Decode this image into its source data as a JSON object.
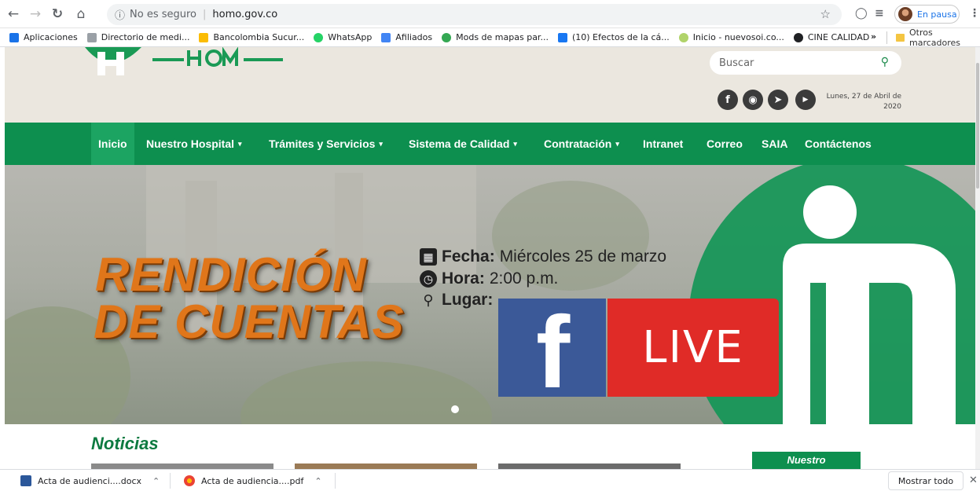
{
  "browser": {
    "security_label": "No es seguro",
    "url": "homo.gov.co",
    "profile_label": "En pausa"
  },
  "bookmarks": {
    "items": [
      {
        "label": "Aplicaciones",
        "color": "#1a73e8"
      },
      {
        "label": "Directorio de medi...",
        "color": "#9aa0a6"
      },
      {
        "label": "Bancolombia Sucur...",
        "color": "#fbbc04"
      },
      {
        "label": "WhatsApp",
        "color": "#25d366"
      },
      {
        "label": "Afiliados",
        "color": "#4285f4"
      },
      {
        "label": "Mods de mapas par...",
        "color": "#34a853"
      },
      {
        "label": "(10) Efectos de la cá...",
        "color": "#1877f2"
      },
      {
        "label": "Inicio - nuevosoi.co...",
        "color": "#b0d36a"
      },
      {
        "label": "CINE CALIDAD",
        "color": "#202124"
      }
    ],
    "more": "»",
    "other": "Otros marcadores"
  },
  "site": {
    "search_placeholder": "Buscar",
    "date": "Lunes, 27 de Abril de 2020",
    "brand_color": "#0d8f4f",
    "nav": [
      {
        "label": "Inicio",
        "dropdown": false
      },
      {
        "label": "Nuestro Hospital",
        "dropdown": true
      },
      {
        "label": "Trámites y Servicios",
        "dropdown": true
      },
      {
        "label": "Sistema de Calidad",
        "dropdown": true
      },
      {
        "label": "Contratación",
        "dropdown": true
      },
      {
        "label": "Intranet",
        "dropdown": false
      },
      {
        "label": "Correo",
        "dropdown": false
      },
      {
        "label": "SAIA",
        "dropdown": false
      },
      {
        "label": "Contáctenos",
        "dropdown": false
      }
    ],
    "hero": {
      "title_line1": "RENDICIÓN",
      "title_line2": "DE CUENTAS",
      "fecha_label": "Fecha:",
      "fecha_value": "Miércoles 25 de marzo",
      "hora_label": "Hora:",
      "hora_value": "2:00 p.m.",
      "lugar_label": "Lugar:",
      "live_f": "f",
      "live_text": "LIVE"
    },
    "news_heading": "Noticias",
    "side_heading": "Nuestro"
  },
  "downloads": {
    "items": [
      {
        "label": "Acta de audienci....docx",
        "type": "docx"
      },
      {
        "label": "Acta de audiencia....pdf",
        "type": "pdf"
      }
    ],
    "show_all": "Mostrar todo"
  }
}
